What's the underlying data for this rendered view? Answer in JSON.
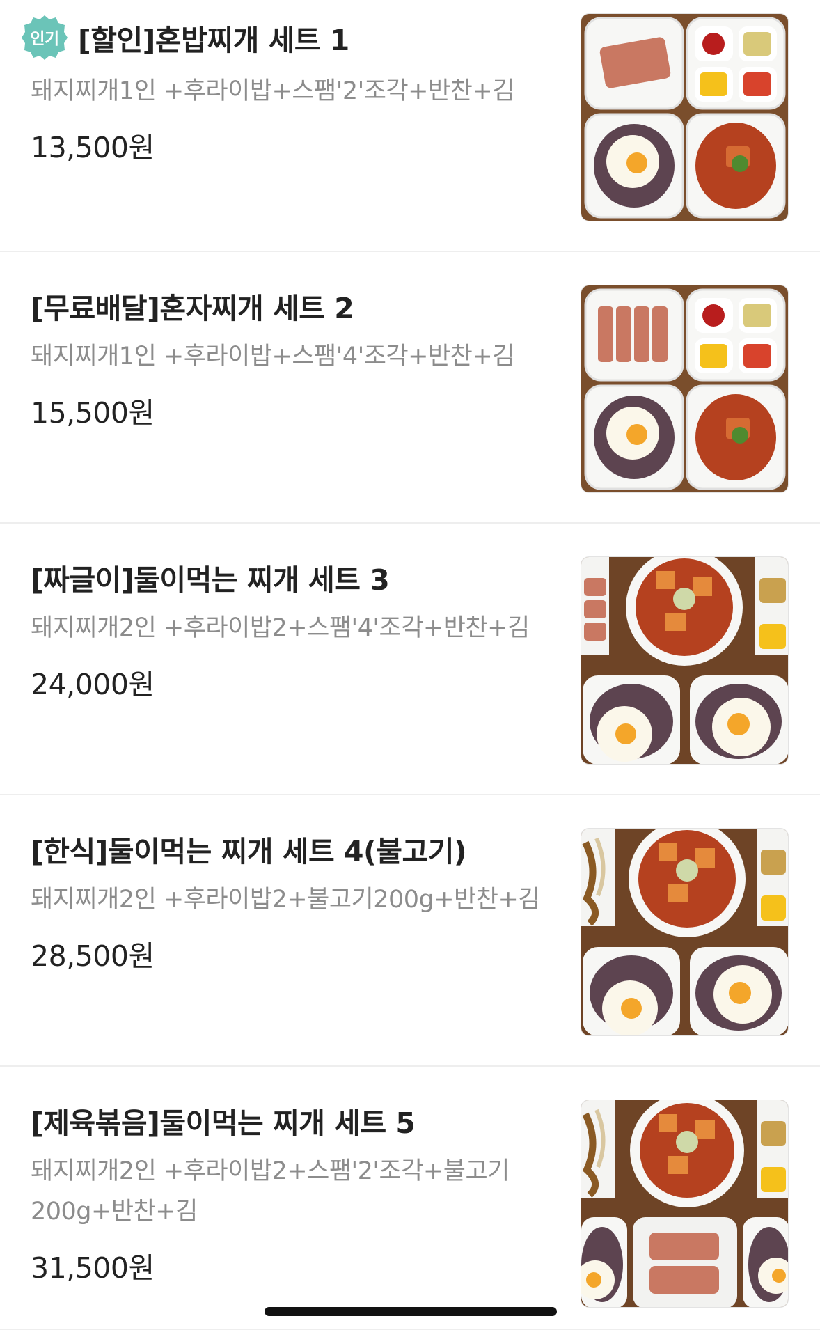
{
  "menu": {
    "items": [
      {
        "badge": "인기",
        "title": "[할인]혼밥찌개 세트 1",
        "description": "돼지찌개1인 +후라이밥+스팸'2'조각+반찬+김",
        "price": "13,500원",
        "image": "food-photo-set-1"
      },
      {
        "title": "[무료배달]혼자찌개 세트 2",
        "description": "돼지찌개1인 +후라이밥+스팸'4'조각+반찬+김",
        "price": "15,500원",
        "image": "food-photo-set-2"
      },
      {
        "title": "[짜글이]둘이먹는 찌개 세트 3",
        "description": "돼지찌개2인 +후라이밥2+스팸'4'조각+반찬+김",
        "price": "24,000원",
        "image": "food-photo-set-3"
      },
      {
        "title": "[한식]둘이먹는 찌개 세트 4(불고기)",
        "description": "돼지찌개2인 +후라이밥2+불고기200g+반찬+김",
        "price": "28,500원",
        "image": "food-photo-set-4"
      },
      {
        "title": "[제육볶음]둘이먹는 찌개 세트 5",
        "description": "돼지찌개2인 +후라이밥2+스팸'2'조각+불고기200g+반찬+김",
        "price": "31,500원",
        "image": "food-photo-set-5"
      }
    ]
  },
  "colors": {
    "badge": "#6bc4b8",
    "title": "#222222",
    "description": "#8c8c8c",
    "divider": "#eeeeee"
  }
}
